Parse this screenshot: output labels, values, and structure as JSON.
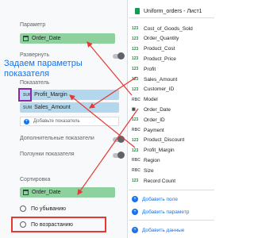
{
  "left": {
    "param_label": "Параметр",
    "param_chip": "Order_Date",
    "expand_label": "Развернуть",
    "metric_label": "Показатель",
    "metric_chips": [
      {
        "type": "SUM",
        "name": "Profit_Margin"
      },
      {
        "type": "SUM",
        "name": "Sales_Amount"
      }
    ],
    "add_metric": "Добавьте показатель",
    "extra_metrics_label": "Дополнительные показатели",
    "sliders_label": "Ползунки показателя",
    "sort_label": "Сортировка",
    "sort_chip": "Order_Date",
    "sort_options": [
      "По убыванию",
      "По возрастанию"
    ]
  },
  "annotation": "Задаем параметры показателя",
  "datasource": {
    "name": "Uniform_orders - Лист1"
  },
  "fields": [
    {
      "type": "123",
      "name": "Cost_of_Goods_Sold"
    },
    {
      "type": "123",
      "name": "Order_Quantity"
    },
    {
      "type": "123",
      "name": "Product_Cost"
    },
    {
      "type": "123",
      "name": "Product_Price"
    },
    {
      "type": "123",
      "name": "Profit"
    },
    {
      "type": "123",
      "name": "Sales_Amount"
    },
    {
      "type": "123",
      "name": "Customer_ID"
    },
    {
      "type": "RBC",
      "name": "Model"
    },
    {
      "type": "cal",
      "name": "Order_Date"
    },
    {
      "type": "123",
      "name": "Order_ID"
    },
    {
      "type": "RBC",
      "name": "Payment"
    },
    {
      "type": "123",
      "name": "Product_Discount"
    },
    {
      "type": "123",
      "name": "Profit_Margin"
    },
    {
      "type": "RBC",
      "name": "Region"
    },
    {
      "type": "RBC",
      "name": "Size"
    },
    {
      "type": "123",
      "name": "Record Count"
    }
  ],
  "links": [
    "Добавить поле",
    "Добавить параметр",
    "Добавить данные"
  ],
  "colors": {
    "annotation": "#1a73e8",
    "highlight_purple": "#8e24aa",
    "highlight_red": "#e53935",
    "arrow": "#e53935",
    "dimension_chip": "#8fd19e",
    "metric_chip": "#b3d7ec"
  }
}
